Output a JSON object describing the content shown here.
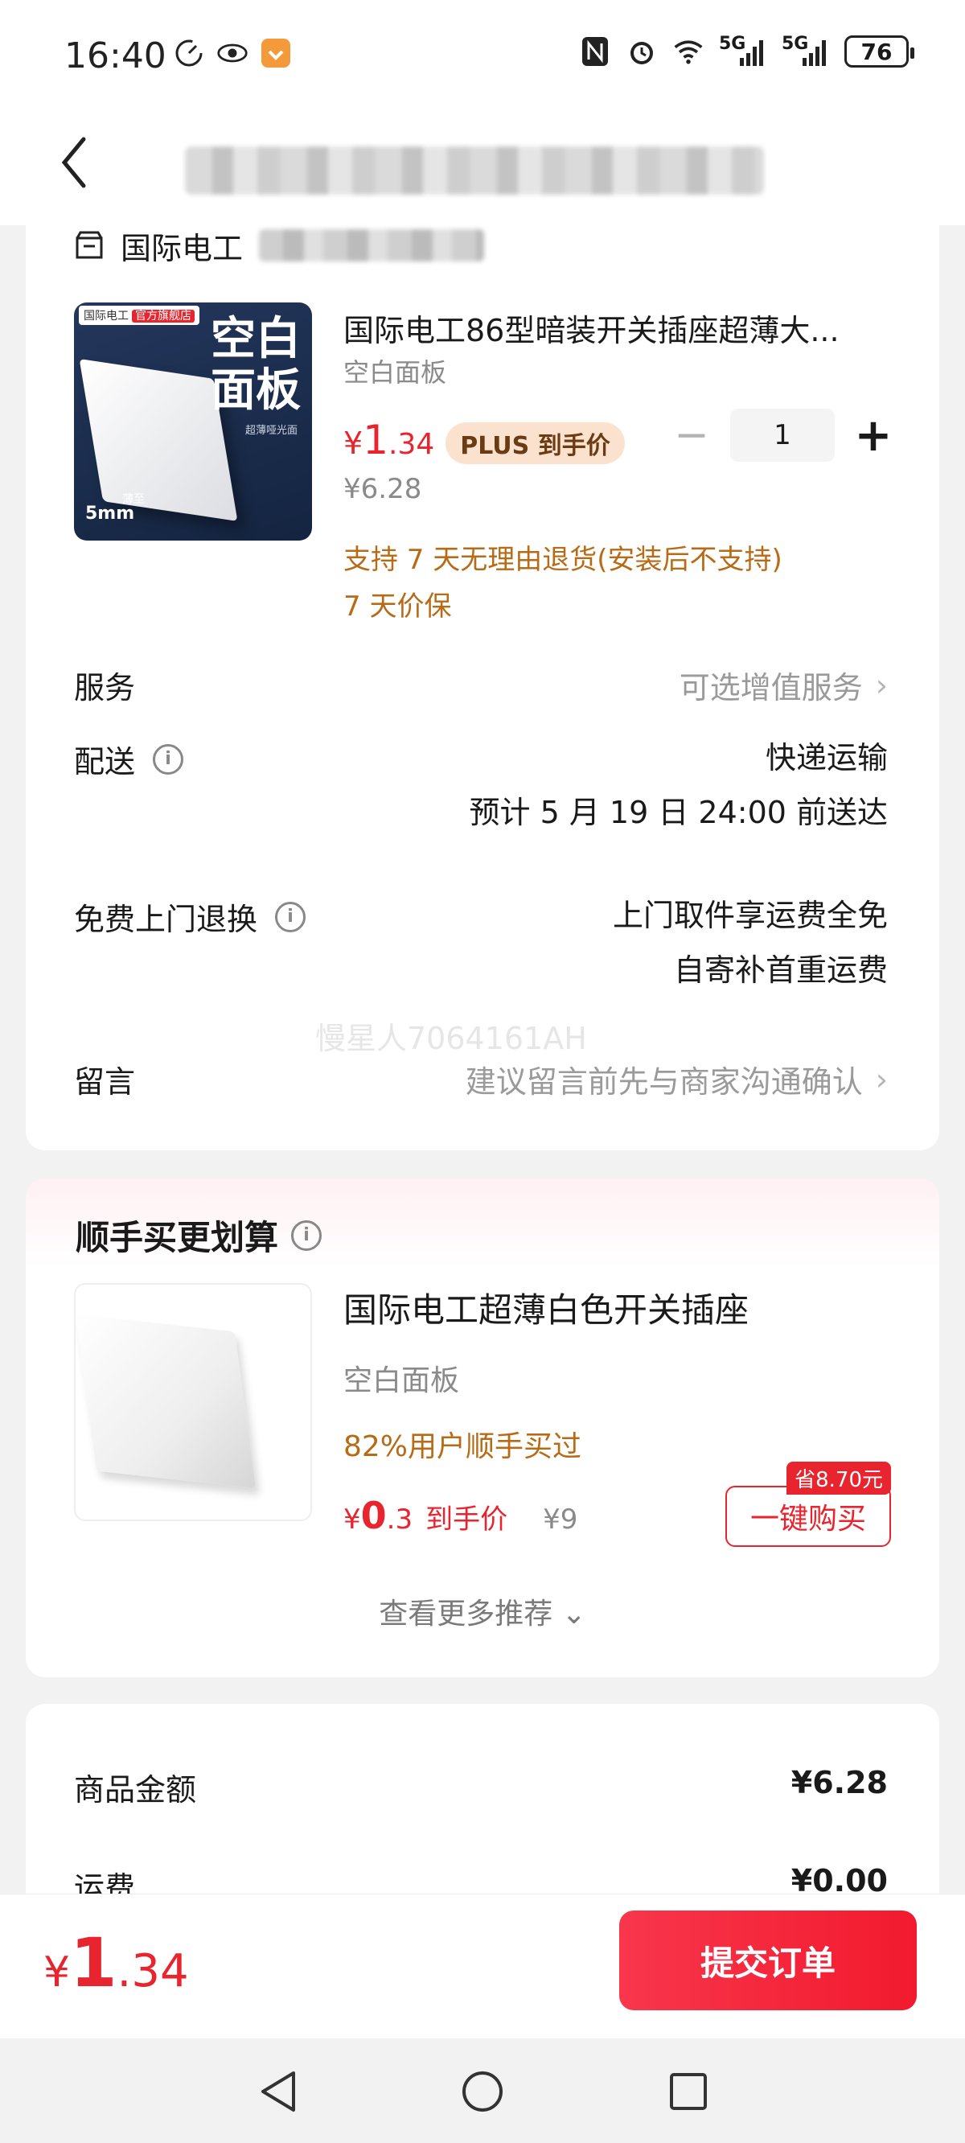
{
  "status_bar": {
    "time": "16:40",
    "battery": "76",
    "net1": "5G",
    "net2": "5G",
    "icons": [
      "speed-icon",
      "eye-icon",
      "app-notification-icon",
      "nfc-icon",
      "alarm-icon",
      "wifi-icon",
      "signal-icon",
      "signal-icon",
      "battery-icon"
    ]
  },
  "nav": {
    "back_icon": "chevron-left-icon"
  },
  "shop": {
    "name": "国际电工"
  },
  "product": {
    "image_tag_brand": "国际电工",
    "image_tag_store": "官方旗舰店",
    "image_big_text_1": "空白",
    "image_big_text_2": "面板",
    "image_small_text": "超薄哑光面",
    "image_thin_text": "薄至",
    "image_mm_text": "5mm",
    "title": "国际电工86型暗装开关插座超薄大...",
    "spec": "空白面板",
    "price_yen": "¥",
    "price_int": "1",
    "price_dec": ".34",
    "plus_badge": "PLUS 到手价",
    "original_price": "¥6.28",
    "quantity": "1",
    "minus": "−",
    "plus": "+",
    "policy_return": "支持 7 天无理由退货(安装后不支持)",
    "policy_price": "7 天价保"
  },
  "service": {
    "label": "服务",
    "value": "可选增值服务"
  },
  "delivery": {
    "label": "配送",
    "method": "快递运输",
    "eta": "预计 5 月 19 日 24:00 前送达"
  },
  "return_service": {
    "label": "免费上门退换",
    "line1": "上门取件享运费全免",
    "line2": "自寄补首重运费"
  },
  "watermark": "慢星人7064161AH",
  "message": {
    "label": "留言",
    "placeholder": "建议留言前先与商家沟通确认"
  },
  "recommend": {
    "title": "顺手买更划算",
    "item_name": "国际电工超薄白色开关插座",
    "item_spec": "空白面板",
    "item_bought": "82%用户顺手买过",
    "price_yen": "¥",
    "price_int": "0",
    "price_dec": ".3",
    "price_suffix": "到手价",
    "original_price": "¥9",
    "save_tag": "省8.70元",
    "buy_label": "一键购买",
    "more_label": "查看更多推荐 ⌄"
  },
  "summary": {
    "goods_label": "商品金额",
    "goods_value": "¥6.28",
    "shipping_label": "运费",
    "shipping_value": "¥0.00"
  },
  "bottom": {
    "total_yen": "¥",
    "total_int": "1",
    "total_dec": ".34",
    "submit_label": "提交订单"
  },
  "colors": {
    "accent": "#e8252e",
    "orange_text": "#b86b16",
    "plus_badge_bg": "#fbe2cf"
  }
}
